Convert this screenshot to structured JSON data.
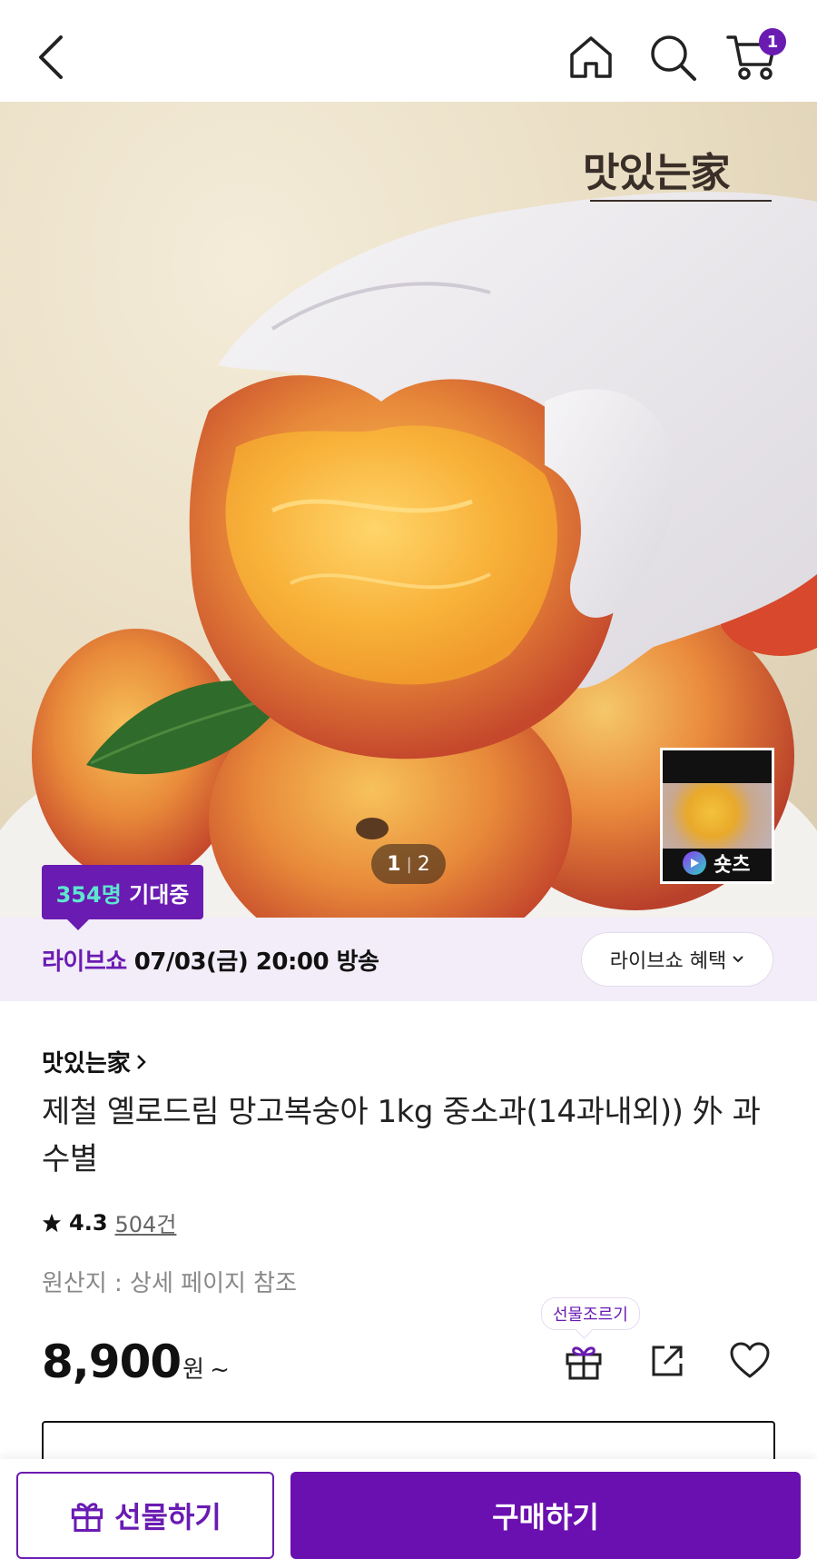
{
  "header": {
    "cart_count": "1"
  },
  "hero": {
    "brand_logo": "맛있는家",
    "page_current": "1",
    "page_separator": "|",
    "page_total": "2",
    "shorts_label": "숏츠",
    "expect_count": "354명",
    "expect_suffix": " 기대중"
  },
  "live": {
    "label": "라이브쇼",
    "schedule": "07/03(금) 20:00 방송",
    "benefit_label": "라이브쇼 혜택"
  },
  "product": {
    "seller": "맛있는家",
    "title": "제철 옐로드림 망고복숭아 1kg 중소과(14과내외)) 外 과수별",
    "rating_score": "4.3",
    "review_count": "504건",
    "origin": "원산지 : 상세 페이지 참조",
    "price": "8,900",
    "price_unit": "원",
    "price_suffix": "~",
    "gift_tooltip": "선물조르기"
  },
  "bottom": {
    "gift_label": "선물하기",
    "buy_label": "구매하기"
  },
  "colors": {
    "accent": "#6a1bb2",
    "live_bg": "#f2edf8",
    "badge_highlight": "#5ee6d0"
  },
  "icons": [
    "back-icon",
    "home-icon",
    "search-icon",
    "cart-icon",
    "play-icon",
    "chevron-down-icon",
    "chevron-right-icon",
    "star-icon",
    "gift-icon",
    "share-icon",
    "heart-icon"
  ]
}
